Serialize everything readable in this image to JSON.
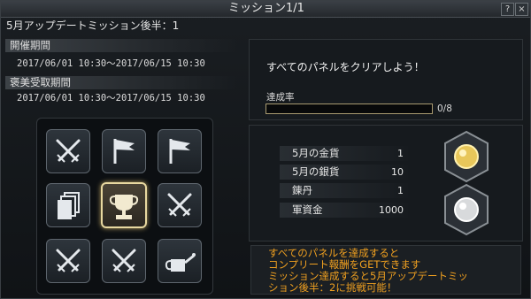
{
  "window": {
    "title": "ミッション1/1",
    "help_label": "?",
    "close_label": "×"
  },
  "mission": {
    "name": "5月アップデートミッション後半：1"
  },
  "held_period": {
    "label": "開催期間",
    "value": "2017/06/01 10:30～2017/06/15 10:30"
  },
  "reward_period": {
    "label": "褒美受取期間",
    "value": "2017/06/01 10:30～2017/06/15 10:30"
  },
  "panels": {
    "icons": [
      "swords-icon",
      "flag-icon",
      "flag-icon",
      "cards-icon",
      "trophy-icon",
      "swords-icon",
      "swords-icon",
      "swords-icon",
      "watering-can-icon"
    ],
    "selected_index": 4
  },
  "objective": {
    "text": "すべてのパネルをクリアしよう！",
    "progress_label": "達成率",
    "progress_value": "0/8",
    "progress_fraction": 0
  },
  "rewards": [
    {
      "name": "5月の金貨",
      "qty": "1"
    },
    {
      "name": "5月の銀貨",
      "qty": "10"
    },
    {
      "name": "錬丹",
      "qty": "1"
    },
    {
      "name": "軍資金",
      "qty": "1000"
    }
  ],
  "coins": [
    "gold-coin-icon",
    "silver-coin-icon"
  ],
  "notice": {
    "lines": [
      "すべてのパネルを達成すると",
      "コンプリート報酬をGETできます",
      "ミッション達成すると5月アップデートミッ",
      "ション後半：2に挑戦可能！"
    ]
  },
  "colors": {
    "notice_text": "#f0a020",
    "panel_highlight": "#e8d8a0",
    "progress_border": "#a89a70"
  }
}
